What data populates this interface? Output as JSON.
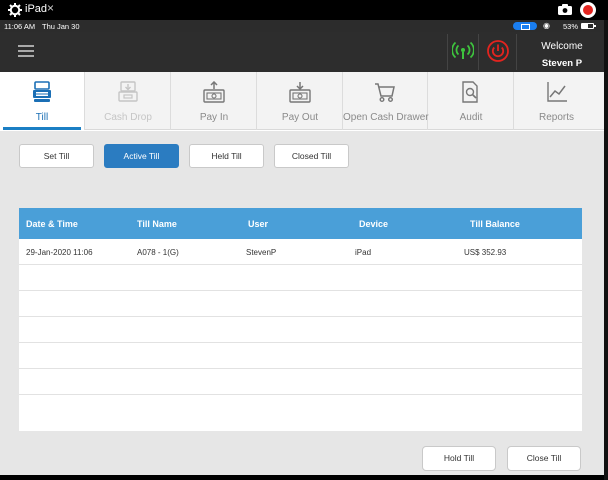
{
  "window": {
    "title": "iPad"
  },
  "status_bar": {
    "time": "11:06 AM",
    "date": "Thu Jan 30",
    "battery": "53%"
  },
  "header": {
    "welcome_label": "Welcome",
    "user_name": "Steven P"
  },
  "main_tabs": [
    {
      "label": "Till",
      "icon": "till-icon",
      "state": "active"
    },
    {
      "label": "Cash Drop",
      "icon": "cash-drop-icon",
      "state": "disabled"
    },
    {
      "label": "Pay In",
      "icon": "pay-in-icon",
      "state": "normal"
    },
    {
      "label": "Pay Out",
      "icon": "pay-out-icon",
      "state": "normal"
    },
    {
      "label": "Open Cash Drawer",
      "icon": "cart-icon",
      "state": "normal"
    },
    {
      "label": "Audit",
      "icon": "audit-icon",
      "state": "normal"
    },
    {
      "label": "Reports",
      "icon": "reports-icon",
      "state": "normal"
    }
  ],
  "sub_tabs": [
    {
      "label": "Set Till"
    },
    {
      "label": "Active Till",
      "active": true
    },
    {
      "label": "Held Till"
    },
    {
      "label": "Closed Till"
    }
  ],
  "table": {
    "columns": [
      "Date & Time",
      "Till Name",
      "User",
      "Device",
      "Till Balance"
    ],
    "rows": [
      [
        "29-Jan-2020 11:06",
        "A078 - 1(G)",
        "StevenP",
        "iPad",
        "US$ 352.93"
      ]
    ]
  },
  "actions": {
    "hold_till": "Hold Till",
    "close_till": "Close Till"
  },
  "colors": {
    "accent": "#2b7cc1",
    "table_header": "#4a9fd8",
    "topbar": "#2d2d2d",
    "network_ok": "#3ec43e",
    "power": "#e3241f"
  }
}
